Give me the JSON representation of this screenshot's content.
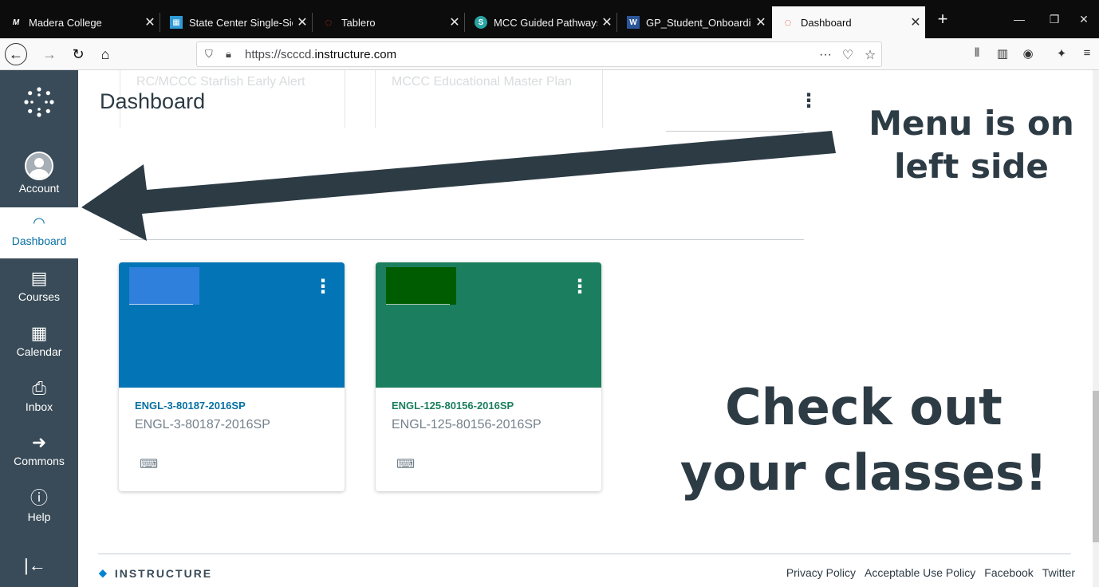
{
  "browser": {
    "tabs": [
      {
        "title": "Madera College",
        "favicon": "M",
        "favicon_color": "#ffffff"
      },
      {
        "title": "State Center Single-Sic",
        "favicon": "▦",
        "favicon_color": "#2e9bd6"
      },
      {
        "title": "Tablero",
        "favicon": "◌",
        "favicon_color": "#e0301e"
      },
      {
        "title": "MCC Guided Pathways",
        "favicon": "S",
        "favicon_color": "#2aa3a3"
      },
      {
        "title": "GP_Student_Onboardi",
        "favicon": "W",
        "favicon_color": "#2b579a"
      },
      {
        "title": "Dashboard",
        "favicon": "◌",
        "favicon_color": "#e0301e"
      }
    ],
    "new_tab": "+",
    "window_controls": [
      "—",
      "❐",
      "✕"
    ],
    "url_prefix": "https://scccd.",
    "url_host": "instructure.com"
  },
  "sidebar": {
    "items": [
      {
        "label": "Account",
        "icon": "user-avatar-icon"
      },
      {
        "label": "Dashboard",
        "icon": "dashboard-gauge-icon"
      },
      {
        "label": "Courses",
        "icon": "book-icon"
      },
      {
        "label": "Calendar",
        "icon": "calendar-icon"
      },
      {
        "label": "Inbox",
        "icon": "inbox-icon"
      },
      {
        "label": "Commons",
        "icon": "commons-arrow-icon"
      },
      {
        "label": "Help",
        "icon": "help-circle-icon"
      }
    ],
    "collapse_glyph": "|←"
  },
  "main": {
    "page_title": "Dashboard",
    "ghost_cards": [
      "RC/MCCC Starfish Early Alert",
      "MCCC Educational Master Plan"
    ],
    "cards": [
      {
        "code": "ENGL-3-80187-2016SP",
        "term": "ENGL-3-80187-2016SP",
        "color": "#0374b5",
        "swatch": "#2f80dd",
        "code_color": "#0770a3"
      },
      {
        "code": "ENGL-125-80156-2016SP",
        "term": "ENGL-125-80156-2016SP",
        "color": "#1b7e5e",
        "swatch": "#005c00",
        "code_color": "#1b7e5e"
      }
    ]
  },
  "annotations": {
    "menu_line1": "Menu is on",
    "menu_line2": "left side",
    "classes_line1": "Check out",
    "classes_line2": "your classes!"
  },
  "footer": {
    "brand": "INSTRUCTURE",
    "links": [
      "Privacy Policy",
      "Acceptable Use Policy",
      "Facebook",
      "Twitter"
    ]
  }
}
